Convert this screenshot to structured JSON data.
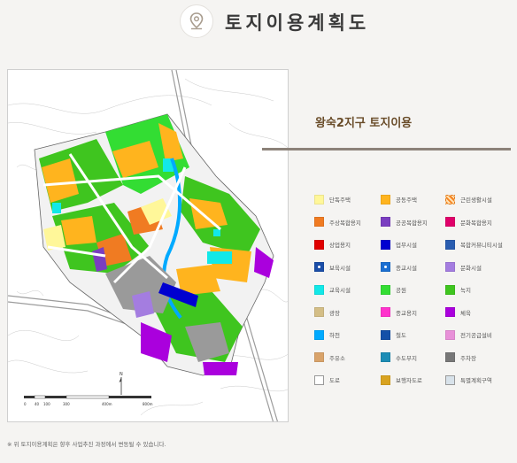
{
  "header": {
    "title": "토지이용계획도",
    "icon": "map-pin-icon"
  },
  "panel": {
    "title": "왕숙2지구 토지이용"
  },
  "legend": [
    {
      "label": "단독주택",
      "color": "#fff799",
      "pattern": "solid"
    },
    {
      "label": "공동주택",
      "color": "#ffb41e",
      "pattern": "solid"
    },
    {
      "label": "근린생활시설",
      "color": "#f58220",
      "pattern": "hatch"
    },
    {
      "label": "주상복합용지",
      "color": "#f07b22",
      "pattern": "solid"
    },
    {
      "label": "공공복합용지",
      "color": "#7a3ec0",
      "pattern": "solid"
    },
    {
      "label": "문화복합용지",
      "color": "#e0006a",
      "pattern": "solid"
    },
    {
      "label": "상업용지",
      "color": "#e00000",
      "pattern": "solid"
    },
    {
      "label": "업무시설",
      "color": "#0000d0",
      "pattern": "solid"
    },
    {
      "label": "복합커뮤니티시설",
      "color": "#2a5db0",
      "pattern": "solid"
    },
    {
      "label": "보육시설",
      "color": "#1b4ea8",
      "pattern": "mark"
    },
    {
      "label": "종교시설",
      "color": "#1b6fd1",
      "pattern": "mark"
    },
    {
      "label": "문화시설",
      "color": "#a47de0",
      "pattern": "solid"
    },
    {
      "label": "교육시설",
      "color": "#12e8e8",
      "pattern": "solid"
    },
    {
      "label": "공원",
      "color": "#33dd33",
      "pattern": "solid"
    },
    {
      "label": "녹지",
      "color": "#3fc51f",
      "pattern": "solid"
    },
    {
      "label": "광장",
      "color": "#d4be86",
      "pattern": "solid"
    },
    {
      "label": "종교용지",
      "color": "#ff33cc",
      "pattern": "solid"
    },
    {
      "label": "체육",
      "color": "#aa00dd",
      "pattern": "solid"
    },
    {
      "label": "하천",
      "color": "#00aaff",
      "pattern": "solid"
    },
    {
      "label": "철도",
      "color": "#1450a8",
      "pattern": "solid"
    },
    {
      "label": "전기공급설비",
      "color": "#e890d8",
      "pattern": "solid"
    },
    {
      "label": "주유소",
      "color": "#d9a36a",
      "pattern": "solid"
    },
    {
      "label": "수도부지",
      "color": "#1d8db5",
      "pattern": "solid"
    },
    {
      "label": "주차장",
      "color": "#777777",
      "pattern": "solid"
    },
    {
      "label": "도로",
      "color": "#ffffff",
      "pattern": "outline"
    },
    {
      "label": "보행자도로",
      "color": "#d9a320",
      "pattern": "solid"
    },
    {
      "label": "특별계획구역",
      "color": "#d8e2ea",
      "pattern": "outline"
    }
  ],
  "map": {
    "scale_labels": [
      "0",
      "40",
      "100",
      "300",
      "400m",
      "800m"
    ],
    "north_label": "N"
  },
  "footnote": "※ 위 토지이용계획은 향후 사업추진 과정에서 변동될 수 있습니다.",
  "colors": {
    "rule": "#8c8279",
    "panel_title": "#6a4d2a"
  }
}
